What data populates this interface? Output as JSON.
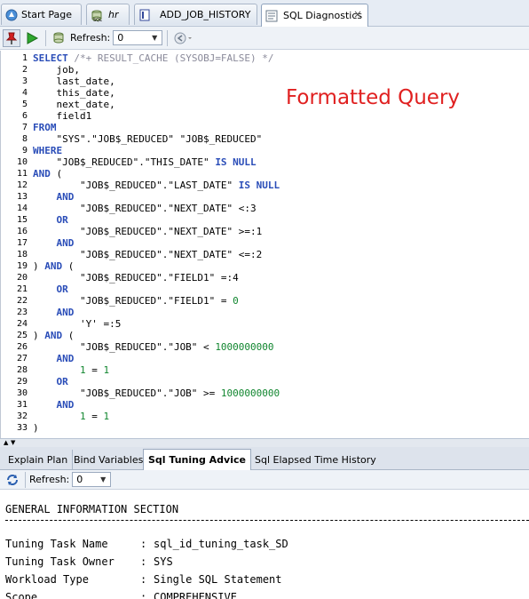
{
  "tabs": [
    {
      "label": "Start Page",
      "icon": "start-page-icon"
    },
    {
      "label": "hr",
      "icon": "database-connection-icon"
    },
    {
      "label": "ADD_JOB_HISTORY",
      "icon": "procedure-icon"
    },
    {
      "label": "SQL Diagnostics",
      "icon": "sql-diagnostics-icon",
      "close": "×"
    }
  ],
  "toolbar": {
    "refresh_label": "Refresh:",
    "refresh_value": "0"
  },
  "editor": {
    "annotation": "Formatted Query",
    "lines": [
      [
        [
          "kw",
          "SELECT"
        ],
        [
          "cm",
          " /*+ RESULT_CACHE (SYSOBJ=FALSE) */"
        ]
      ],
      [
        [
          "t",
          "    job,"
        ]
      ],
      [
        [
          "t",
          "    last_date,"
        ]
      ],
      [
        [
          "t",
          "    this_date,"
        ]
      ],
      [
        [
          "t",
          "    next_date,"
        ]
      ],
      [
        [
          "t",
          "    field1"
        ]
      ],
      [
        [
          "kw",
          "FROM"
        ]
      ],
      [
        [
          "t",
          "    \"SYS\".\"JOB$_REDUCED\" \"JOB$_REDUCED\""
        ]
      ],
      [
        [
          "kw",
          "WHERE"
        ]
      ],
      [
        [
          "t",
          "    \"JOB$_REDUCED\".\"THIS_DATE\" "
        ],
        [
          "kw",
          "IS NULL"
        ]
      ],
      [
        [
          "kw",
          "AND"
        ],
        [
          "t",
          " ("
        ]
      ],
      [
        [
          "t",
          "        \"JOB$_REDUCED\".\"LAST_DATE\" "
        ],
        [
          "kw",
          "IS NULL"
        ]
      ],
      [
        [
          "t",
          "    "
        ],
        [
          "kw",
          "AND"
        ]
      ],
      [
        [
          "t",
          "        \"JOB$_REDUCED\".\"NEXT_DATE\" <:3"
        ]
      ],
      [
        [
          "t",
          "    "
        ],
        [
          "kw",
          "OR"
        ]
      ],
      [
        [
          "t",
          "        \"JOB$_REDUCED\".\"NEXT_DATE\" >=:1"
        ]
      ],
      [
        [
          "t",
          "    "
        ],
        [
          "kw",
          "AND"
        ]
      ],
      [
        [
          "t",
          "        \"JOB$_REDUCED\".\"NEXT_DATE\" <=:2"
        ]
      ],
      [
        [
          "t",
          ") "
        ],
        [
          "kw",
          "AND"
        ],
        [
          "t",
          " ("
        ]
      ],
      [
        [
          "t",
          "        \"JOB$_REDUCED\".\"FIELD1\" =:4"
        ]
      ],
      [
        [
          "t",
          "    "
        ],
        [
          "kw",
          "OR"
        ]
      ],
      [
        [
          "t",
          "        \"JOB$_REDUCED\".\"FIELD1\" = "
        ],
        [
          "num",
          "0"
        ]
      ],
      [
        [
          "t",
          "    "
        ],
        [
          "kw",
          "AND"
        ]
      ],
      [
        [
          "t",
          "        'Y' =:5"
        ]
      ],
      [
        [
          "t",
          ") "
        ],
        [
          "kw",
          "AND"
        ],
        [
          "t",
          " ("
        ]
      ],
      [
        [
          "t",
          "        \"JOB$_REDUCED\".\"JOB\" < "
        ],
        [
          "num",
          "1000000000"
        ]
      ],
      [
        [
          "t",
          "    "
        ],
        [
          "kw",
          "AND"
        ]
      ],
      [
        [
          "t",
          "        "
        ],
        [
          "num",
          "1"
        ],
        [
          "t",
          " = "
        ],
        [
          "num",
          "1"
        ]
      ],
      [
        [
          "t",
          "    "
        ],
        [
          "kw",
          "OR"
        ]
      ],
      [
        [
          "t",
          "        \"JOB$_REDUCED\".\"JOB\" >= "
        ],
        [
          "num",
          "1000000000"
        ]
      ],
      [
        [
          "t",
          "    "
        ],
        [
          "kw",
          "AND"
        ]
      ],
      [
        [
          "t",
          "        "
        ],
        [
          "num",
          "1"
        ],
        [
          "t",
          " = "
        ],
        [
          "num",
          "1"
        ]
      ],
      [
        [
          "t",
          ")"
        ]
      ]
    ]
  },
  "subtabs": [
    {
      "label": "Explain Plan",
      "active": false
    },
    {
      "label": "Bind Variables",
      "active": false
    },
    {
      "label": "Sql Tuning Advice",
      "active": true
    },
    {
      "label": "Sql Elapsed Time History",
      "active": false
    }
  ],
  "subtoolbar": {
    "refresh_label": "Refresh:",
    "refresh_value": "0"
  },
  "advice": {
    "section_title": "GENERAL INFORMATION SECTION",
    "rows": [
      {
        "key": "Tuning Task Name",
        "value": "sql_id_tuning_task_SD"
      },
      {
        "key": "Tuning Task Owner",
        "value": "SYS"
      },
      {
        "key": "Workload Type",
        "value": "Single SQL Statement"
      },
      {
        "key": "Scope",
        "value": "COMPREHENSIVE"
      }
    ]
  },
  "colors": {
    "keyword": "#2a4db8",
    "comment": "#8a8a9a",
    "number": "#11862f",
    "annotation": "#e02020"
  }
}
